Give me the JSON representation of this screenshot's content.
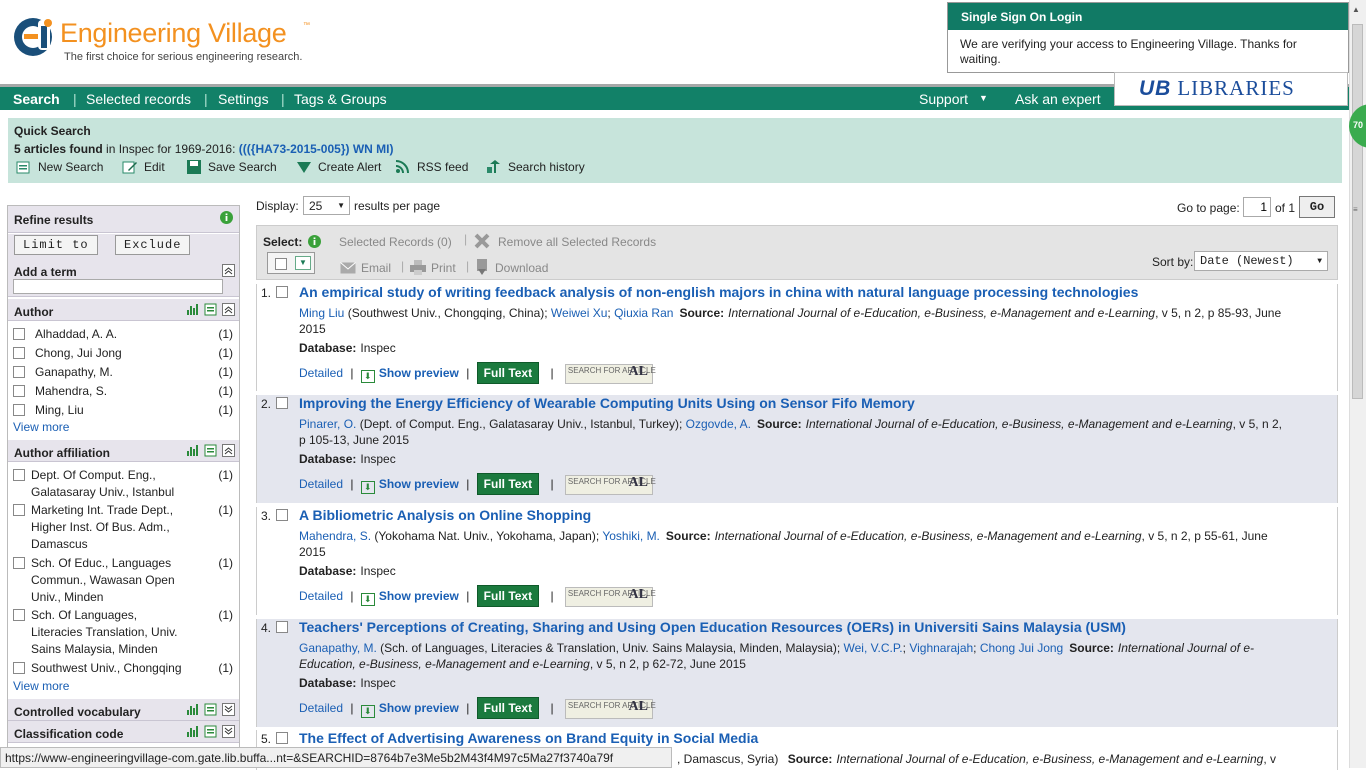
{
  "header": {
    "title": "Engineering Village",
    "tm": "™",
    "tagline": "The first choice for serious engineering research."
  },
  "sso": {
    "title": "Single Sign On Login",
    "message": "We are verifying your access to Engineering Village. Thanks for waiting."
  },
  "ub": {
    "mark": "UB",
    "label": "LIBRARIES"
  },
  "nav": {
    "search": "Search",
    "selected": "Selected records",
    "settings": "Settings",
    "tags": "Tags & Groups",
    "support": "Support",
    "expert": "Ask an expert"
  },
  "quick": {
    "title": "Quick Search",
    "count": "5 articles found",
    "in": " in Inspec for 1969-2016: ",
    "query": "((({HA73-2015-005}) WN MI)",
    "tools": [
      "New Search",
      "Edit",
      "Save Search",
      "Create Alert",
      "RSS feed",
      "Search history"
    ]
  },
  "refine": {
    "title": "Refine results",
    "limit": "Limit to",
    "exclude": "Exclude",
    "add_term": "Add a term",
    "author_title": "Author",
    "authors": [
      {
        "name": "Alhaddad, A. A.",
        "count": "(1)"
      },
      {
        "name": "Chong, Jui Jong",
        "count": "(1)"
      },
      {
        "name": "Ganapathy, M.",
        "count": "(1)"
      },
      {
        "name": "Mahendra, S.",
        "count": "(1)"
      },
      {
        "name": "Ming, Liu",
        "count": "(1)"
      }
    ],
    "view_more": "View more",
    "affil_title": "Author affiliation",
    "affils": [
      {
        "name": "Dept. Of Comput. Eng., Galatasaray Univ., Istanbul",
        "count": "(1)"
      },
      {
        "name": "Marketing Int. Trade Dept., Higher Inst. Of Bus. Adm., Damascus",
        "count": "(1)"
      },
      {
        "name": "Sch. Of Educ., Languages Commun., Wawasan Open Univ., Minden",
        "count": "(1)"
      },
      {
        "name": "Sch. Of Languages, Literacies Translation, Univ. Sains Malaysia, Minden",
        "count": "(1)"
      },
      {
        "name": "Southwest Univ., Chongqing",
        "count": "(1)"
      }
    ],
    "ctrl_vocab": "Controlled vocabulary",
    "class_code": "Classification code"
  },
  "display": {
    "label": "Display:",
    "value": "25",
    "suffix": "results per page",
    "goto": "Go to page:",
    "page": "1",
    "of": "of 1",
    "go": "Go"
  },
  "select": {
    "label": "Select:",
    "selected": "Selected Records (0)",
    "remove": "Remove all Selected Records",
    "email": "Email",
    "print": "Print",
    "download": "Download",
    "sort_label": "Sort by:",
    "sort_value": "Date (Newest)"
  },
  "results": [
    {
      "n": "1.",
      "title": "An empirical study of writing feedback analysis of non-english majors in china with natural language processing technologies",
      "authors": [
        {
          "name": "Ming Liu",
          "aff": " (Southwest Univ., Chongqing, China); "
        },
        {
          "name": "Weiwei Xu",
          "aff": "; "
        },
        {
          "name": "Qiuxia Ran",
          "aff": ""
        }
      ],
      "source": "International Journal of e-Education, e-Business, e-Management and e-Learning",
      "details": ", v 5, n 2, p 85-93, June 2015"
    },
    {
      "n": "2.",
      "title": "Improving the Energy Efficiency of Wearable Computing Units Using on Sensor Fifo Memory",
      "authors": [
        {
          "name": "Pinarer, O.",
          "aff": " (Dept. of Comput. Eng., Galatasaray Univ., Istanbul, Turkey); "
        },
        {
          "name": "Ozgovde, A.",
          "aff": ""
        }
      ],
      "source": "International Journal of e-Education, e-Business, e-Management and e-Learning",
      "details": ", v 5, n 2, p 105-13, June 2015"
    },
    {
      "n": "3.",
      "title": "A Bibliometric Analysis on Online Shopping",
      "authors": [
        {
          "name": "Mahendra, S.",
          "aff": " (Yokohama Nat. Univ., Yokohama, Japan); "
        },
        {
          "name": "Yoshiki, M.",
          "aff": ""
        }
      ],
      "source": "International Journal of e-Education, e-Business, e-Management and e-Learning",
      "details": ", v 5, n 2, p 55-61, June 2015"
    },
    {
      "n": "4.",
      "title": "Teachers' Perceptions of Creating, Sharing and Using Open Education Resources (OERs) in Universiti Sains Malaysia (USM)",
      "authors": [
        {
          "name": "Ganapathy, M.",
          "aff": " (Sch. of Languages, Literacies & Translation, Univ. Sains Malaysia, Minden, Malaysia); "
        },
        {
          "name": "Wei, V.C.P.",
          "aff": "; "
        },
        {
          "name": "Vighnarajah",
          "aff": "; "
        },
        {
          "name": "Chong Jui Jong",
          "aff": ""
        }
      ],
      "source": "International Journal of e-Education, e-Business, e-Management and e-Learning",
      "details": ", v 5, n 2, p 62-72, June 2015"
    },
    {
      "n": "5.",
      "title": "The Effect of Advertising Awareness on Brand Equity in Social Media",
      "authors": [
        {
          "name": "",
          "aff": ", Damascus, Syria) "
        }
      ],
      "source": "International Journal of e-Education, e-Business, e-Management and e-Learning",
      "details": ", v"
    }
  ],
  "labels": {
    "source": "Source:",
    "database": "Database:",
    "db_value": "Inspec",
    "detailed": "Detailed",
    "preview": "Show preview",
    "fulltext": "Full Text",
    "sfa": "SEARCH FOR ARTICLE",
    "sfa_mark": "AL"
  },
  "status_url": "https://www-engineeringvillage-com.gate.lib.buffa...nt=&SEARCHID=8764b7e3Me5b2M43f4M97c5Ma27f3740a79f",
  "badge": "70",
  "colors": {
    "brand_orange": "#f39120",
    "nav_green": "#128168",
    "link_blue": "#1a5fb4",
    "fulltext_green": "#1b7a3e"
  }
}
